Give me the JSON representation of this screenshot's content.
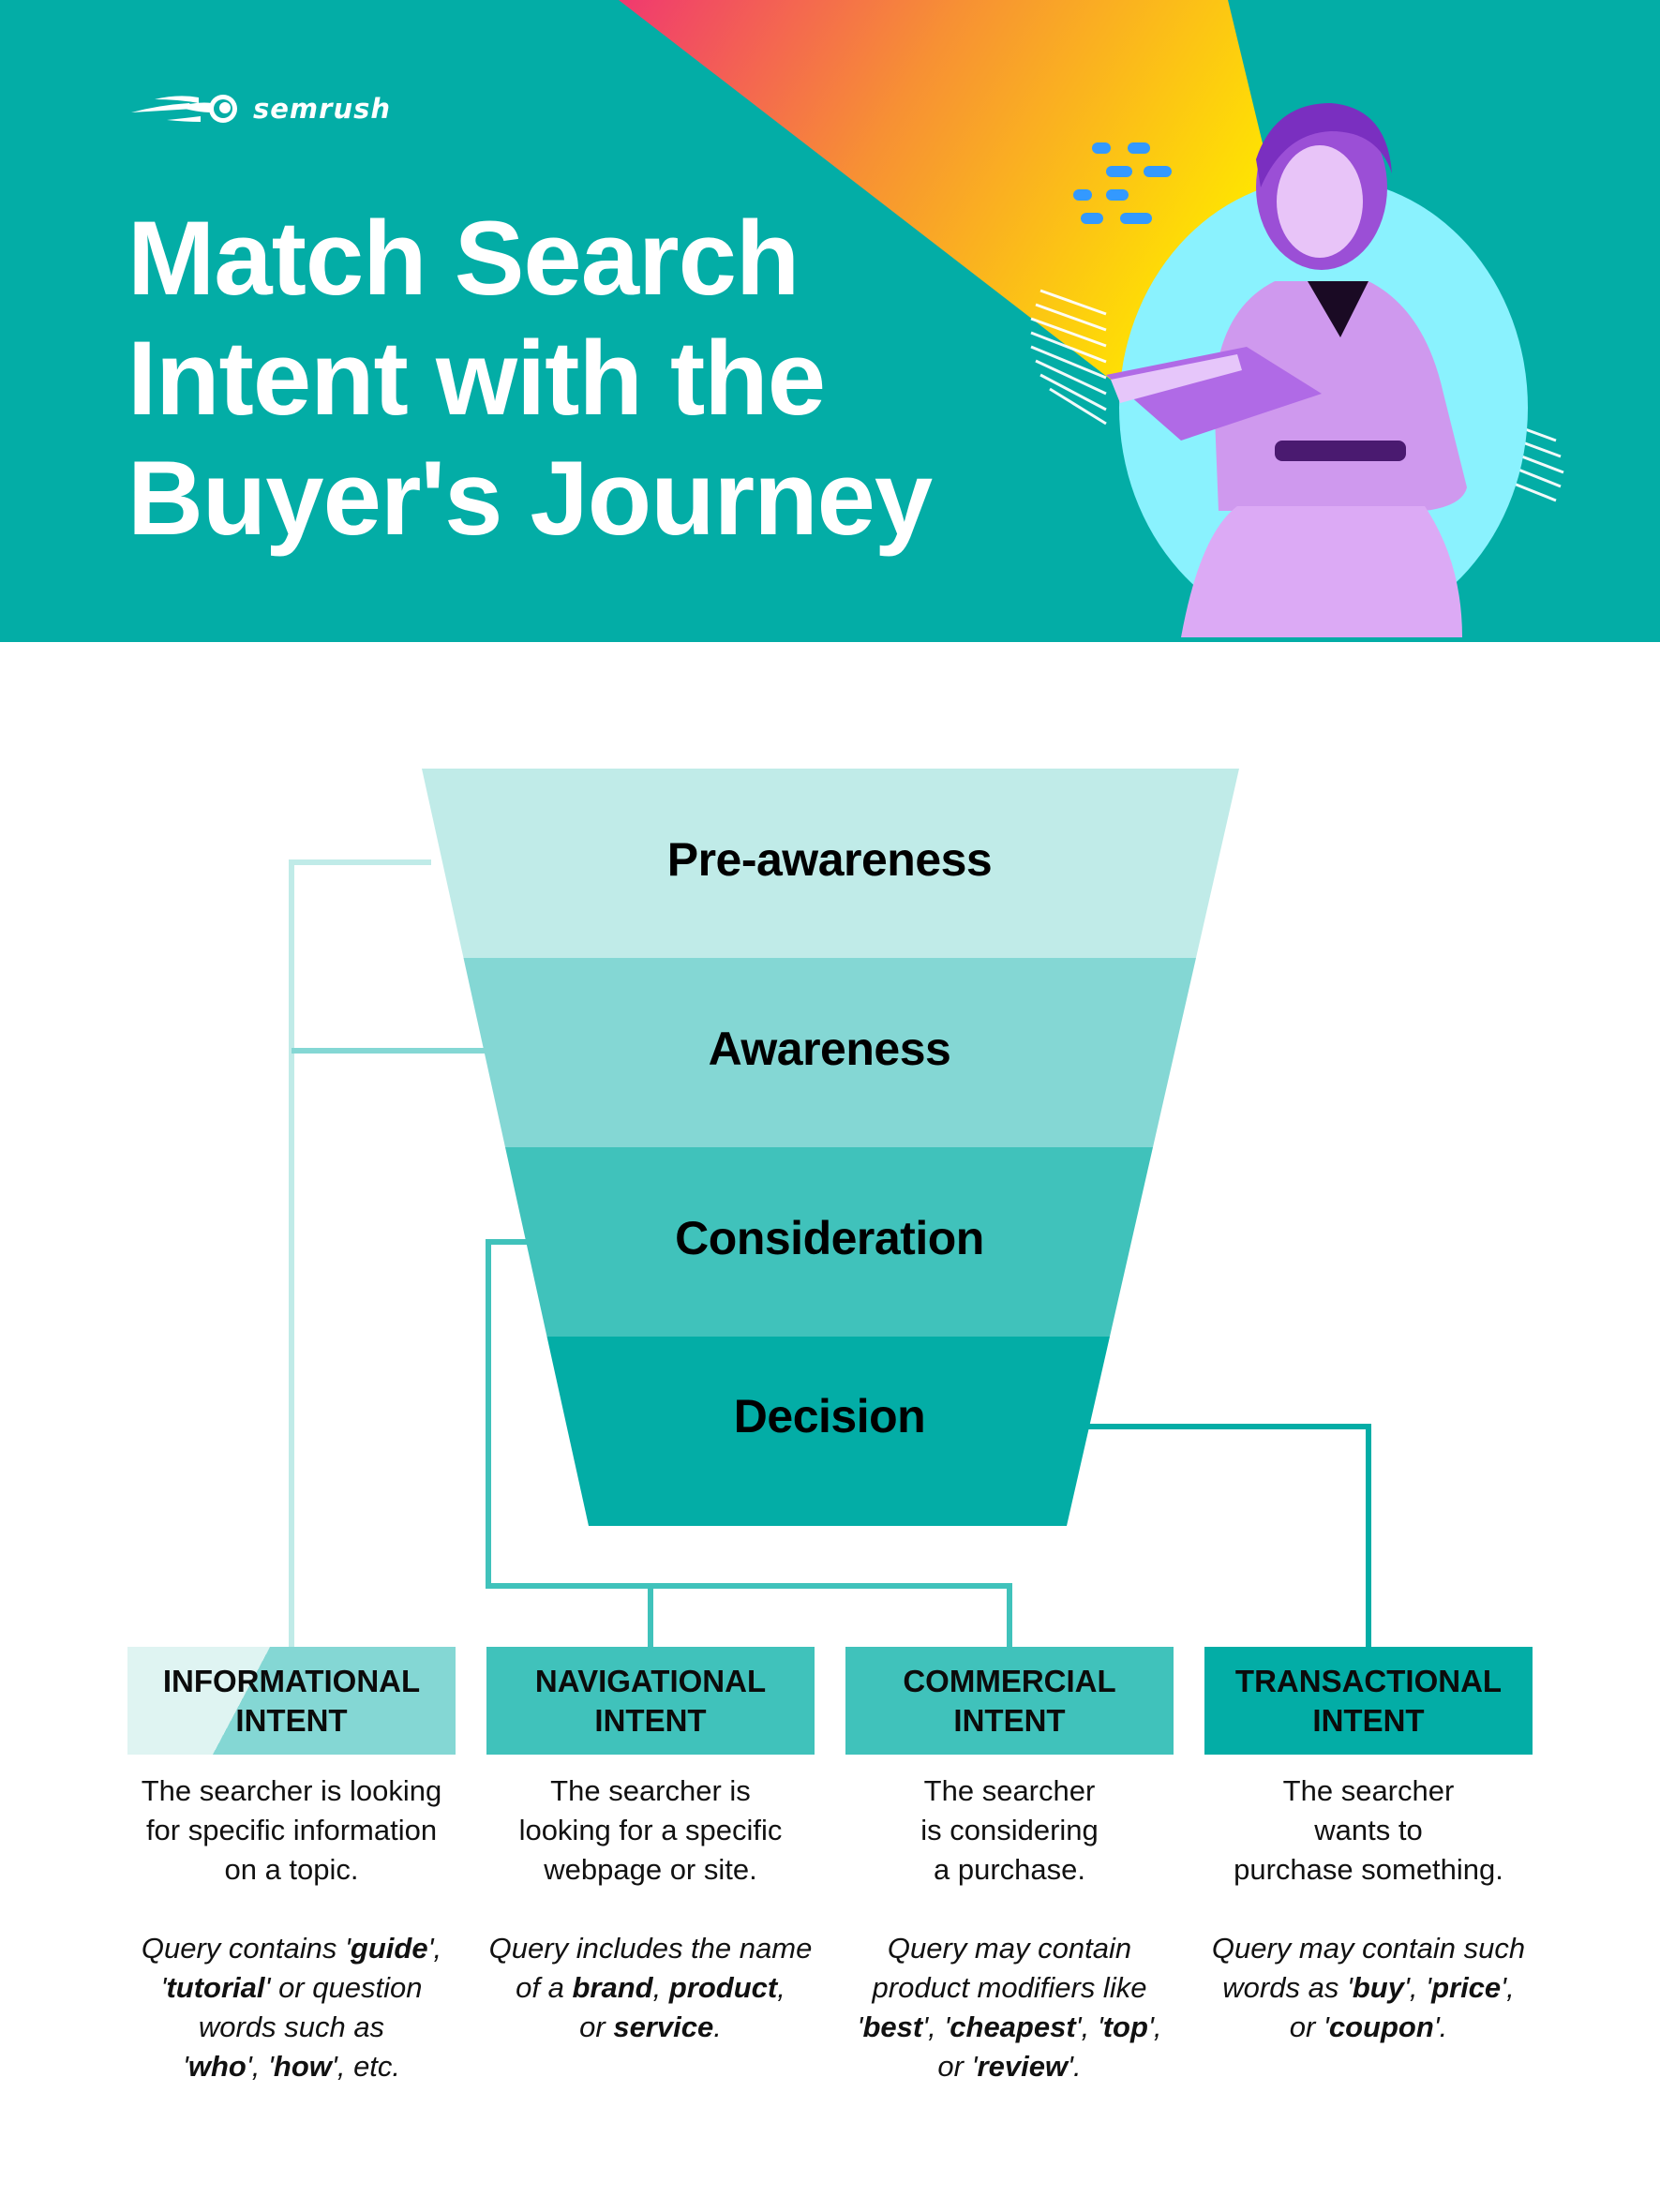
{
  "brand": {
    "name": "semrush",
    "logo_icon": "comet-logo-icon"
  },
  "header": {
    "title_lines": [
      "Match Search",
      "Intent with the",
      "Buyer's Journey"
    ],
    "illustration": "woman-reading-book-illustration",
    "colors": {
      "background": "#03ada6",
      "beam_start": "#f0396f",
      "beam_mid": "#f79034",
      "beam_end": "#ffe600",
      "circle": "#8af2fe",
      "dashes": "#3399ff"
    }
  },
  "funnel": {
    "stages": [
      {
        "label": "Pre-awareness",
        "color": "#c0ebe8"
      },
      {
        "label": "Awareness",
        "color": "#84d7d4"
      },
      {
        "label": "Consideration",
        "color": "#40c2bb"
      },
      {
        "label": "Decision",
        "color": "#03ada6"
      }
    ]
  },
  "intents": [
    {
      "title_line1": "INFORMATIONAL",
      "title_line2": "INTENT",
      "desc_lines": [
        "The searcher is looking",
        "for specific information",
        "on a topic."
      ],
      "query_html": "Query contains '<b>guide</b>',<br>'<b>tutorial</b>' or question<br>words such as<br>'<b>who</b>', '<b>how</b>', etc.",
      "linked_stages": [
        "Pre-awareness",
        "Awareness"
      ]
    },
    {
      "title_line1": "NAVIGATIONAL",
      "title_line2": "INTENT",
      "desc_lines": [
        "The searcher is",
        "looking for a specific",
        "webpage or site."
      ],
      "query_html": "Query includes the name<br>of a <b>brand</b>, <b>product</b>,<br>or <b>service</b>.",
      "linked_stages": [
        "Consideration"
      ]
    },
    {
      "title_line1": "COMMERCIAL",
      "title_line2": "INTENT",
      "desc_lines": [
        "The searcher",
        "is considering",
        "a purchase."
      ],
      "query_html": "Query may contain<br>product modifiers like<br>'<b>best</b>', '<b>cheapest</b>', '<b>top</b>',<br>or '<b>review</b>'.",
      "linked_stages": [
        "Consideration"
      ]
    },
    {
      "title_line1": "TRANSACTIONAL",
      "title_line2": "INTENT",
      "desc_lines": [
        "The searcher",
        "wants to",
        "purchase something."
      ],
      "query_html": "Query may contain such<br>words as '<b>buy</b>', '<b>price</b>',<br>or '<b>coupon</b>'.",
      "linked_stages": [
        "Decision"
      ]
    }
  ]
}
